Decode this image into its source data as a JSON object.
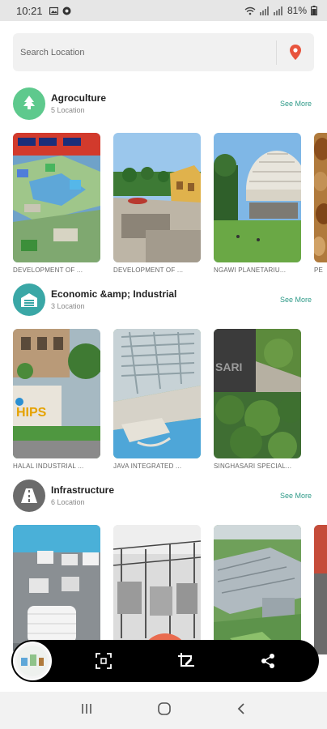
{
  "status_bar": {
    "time": "10:21",
    "battery": "81%"
  },
  "search": {
    "placeholder": "Search Location"
  },
  "sections": [
    {
      "title": "Agroculture",
      "count": "5 Location",
      "see_more": "See More",
      "icon": "tree-icon",
      "icon_color": "#5ec98d",
      "cards": [
        "DEVELOPMENT OF ...",
        "DEVELOPMENT OF ...",
        "NGAWI PLANETARIU...",
        "PE"
      ]
    },
    {
      "title": "Economic &amp; Industrial",
      "count": "3 Location",
      "see_more": "See More",
      "icon": "factory-icon",
      "icon_color": "#3aa7a6",
      "cards": [
        "HALAL INDUSTRIAL ...",
        "JAVA INTEGRATED ...",
        "SINGHASARI SPECIAL..."
      ]
    },
    {
      "title": "Infrastructure",
      "count": "6 Location",
      "see_more": "See More",
      "icon": "road-icon",
      "icon_color": "#6b6b6b",
      "cards": [
        "",
        "",
        "",
        ""
      ]
    }
  ],
  "image_text": {
    "sari": "SARI",
    "hips": "HIPS"
  },
  "colors": {
    "accent": "#2e9a88",
    "pin": "#e8543d"
  }
}
